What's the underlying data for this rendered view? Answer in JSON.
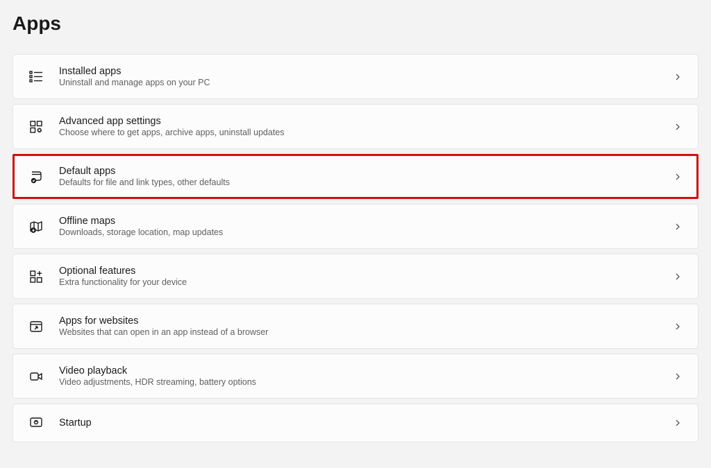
{
  "page": {
    "title": "Apps"
  },
  "items": [
    {
      "icon": "installed-apps-icon",
      "title": "Installed apps",
      "desc": "Uninstall and manage apps on your PC",
      "highlighted": false
    },
    {
      "icon": "advanced-app-settings-icon",
      "title": "Advanced app settings",
      "desc": "Choose where to get apps, archive apps, uninstall updates",
      "highlighted": false
    },
    {
      "icon": "default-apps-icon",
      "title": "Default apps",
      "desc": "Defaults for file and link types, other defaults",
      "highlighted": true
    },
    {
      "icon": "offline-maps-icon",
      "title": "Offline maps",
      "desc": "Downloads, storage location, map updates",
      "highlighted": false
    },
    {
      "icon": "optional-features-icon",
      "title": "Optional features",
      "desc": "Extra functionality for your device",
      "highlighted": false
    },
    {
      "icon": "apps-for-websites-icon",
      "title": "Apps for websites",
      "desc": "Websites that can open in an app instead of a browser",
      "highlighted": false
    },
    {
      "icon": "video-playback-icon",
      "title": "Video playback",
      "desc": "Video adjustments, HDR streaming, battery options",
      "highlighted": false
    },
    {
      "icon": "startup-icon",
      "title": "Startup",
      "desc": "",
      "highlighted": false
    }
  ]
}
